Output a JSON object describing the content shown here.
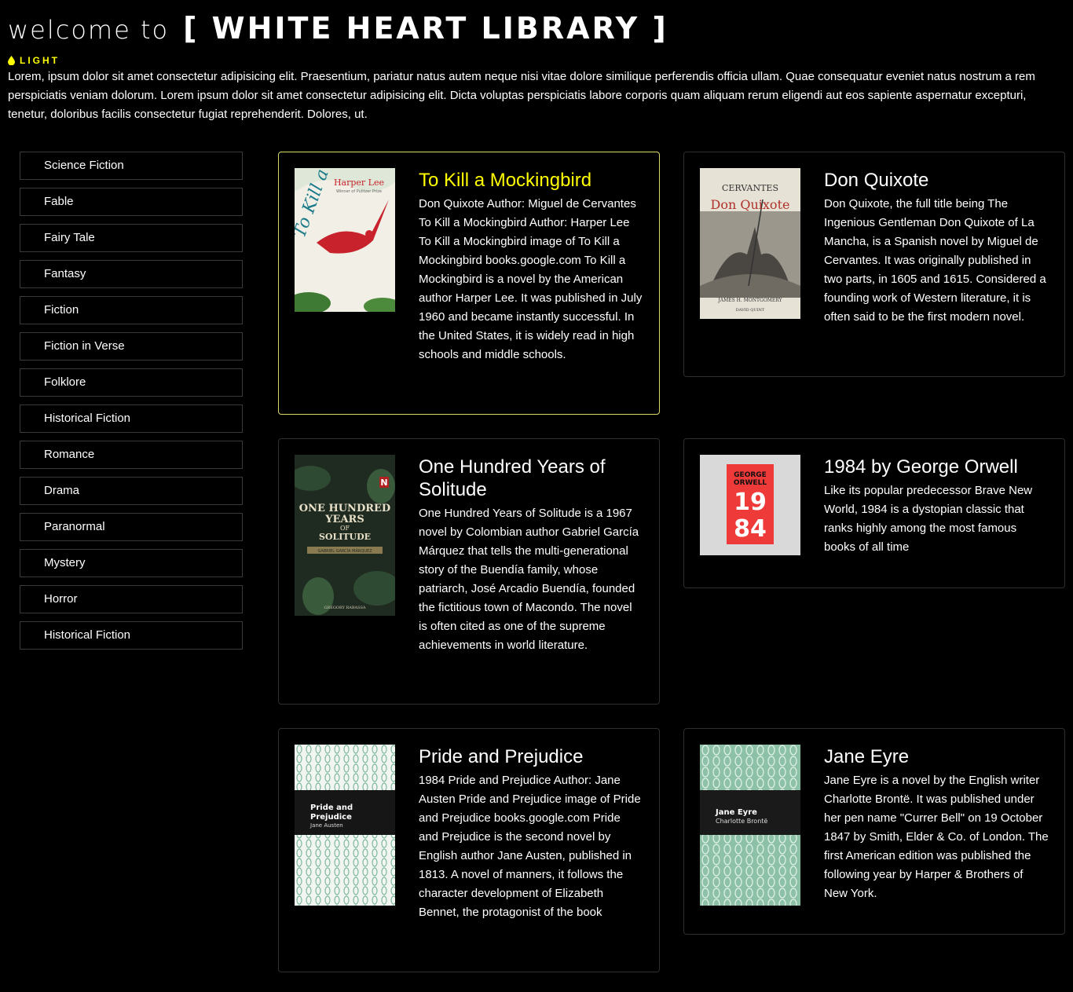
{
  "header": {
    "welcome": "welcome to",
    "library": "[ WHITE HEART LIBRARY ]",
    "toggle_label": "LIGHT",
    "intro": "Lorem, ipsum dolor sit amet consectetur adipisicing elit. Praesentium, pariatur natus autem neque nisi vitae dolore similique perferendis officia ullam. Quae consequatur eveniet natus nostrum a rem perspiciatis veniam dolorum. Lorem ipsum dolor sit amet consectetur adipisicing elit. Dicta voluptas perspiciatis labore corporis quam aliquam rerum eligendi aut eos sapiente aspernatur excepturi, tenetur, doloribus facilis consectetur fugiat reprehenderit. Dolores, ut."
  },
  "sidebar": {
    "items": [
      "Science Fiction",
      "Fable",
      "Fairy Tale",
      "Fantasy",
      "Fiction",
      "Fiction in Verse",
      "Folklore",
      "Historical Fiction",
      "Romance",
      "Drama",
      "Paranormal",
      "Mystery",
      "Horror",
      "Historical Fiction"
    ]
  },
  "books": [
    {
      "title": "To Kill a Mockingbird",
      "description": "Don Quixote Author: Miguel de Cervantes To Kill a Mockingbird Author: Harper Lee To Kill a Mockingbird image of To Kill a Mockingbird books.google.com To Kill a Mockingbird is a novel by the American author Harper Lee. It was published in July 1960 and became instantly successful. In the United States, it is widely read in high schools and middle schools.",
      "cover": {
        "author": "Harper Lee",
        "tagline": "Winner of Pulitzer Prize",
        "script": "To Kill a Mocking bird"
      },
      "active": true
    },
    {
      "title": "Don Quixote",
      "description": "Don Quixote, the full title being The Ingenious Gentleman Don Quixote of La Mancha, is a Spanish novel by Miguel de Cervantes. It was originally published in two parts, in 1605 and 1615. Considered a founding work of Western literature, it is often said to be the first modern novel.",
      "cover": {
        "author": "CERVANTES",
        "script": "Don Quixote",
        "credit": "JAMES H. MONTGOMERY",
        "credit2": "DAVID QUINT"
      }
    },
    {
      "title": "One Hundred Years of Solitude",
      "description": "One Hundred Years of Solitude is a 1967 novel by Colombian author Gabriel García Márquez that tells the multi-generational story of the Buendía family, whose patriarch, José Arcadio Buendía, founded the fictitious town of Macondo. The novel is often cited as one of the supreme achievements in world literature.",
      "cover": {
        "line1": "ONE HUNDRED",
        "line2": "YEARS",
        "line3": "OF",
        "line4": "SOLITUDE",
        "author": "GABRIEL GARCÍA MÁRQUEZ",
        "credit": "GREGORY RABASSA",
        "badge": "N"
      }
    },
    {
      "title": "1984 by George Orwell",
      "description": "Like its popular predecessor Brave New World, 1984 is a dystopian classic that ranks highly among the most famous books of all time",
      "cover": {
        "author1": "GEORGE",
        "author2": "ORWELL",
        "top": "19",
        "bottom": "84"
      }
    },
    {
      "title": "Pride and Prejudice",
      "description": "1984 Pride and Prejudice Author: Jane Austen Pride and Prejudice image of Pride and Prejudice books.google.com Pride and Prejudice is the second novel by English author Jane Austen, published in 1813. A novel of manners, it follows the character development of Elizabeth Bennet, the protagonist of the book",
      "cover": {
        "line1": "Pride and",
        "line2": "Prejudice",
        "author": "Jane Austen"
      }
    },
    {
      "title": "Jane Eyre",
      "description": "Jane Eyre is a novel by the English writer Charlotte Brontë. It was published under her pen name \"Currer Bell\" on 19 October 1847 by Smith, Elder & Co. of London. The first American edition was published the following year by Harper & Brothers of New York.",
      "cover": {
        "line1": "Jane Eyre",
        "author": "Charlotte Brontë"
      }
    }
  ],
  "colors": {
    "background": "#000000",
    "accent": "#ffff00",
    "active_border": "#d9d96a",
    "card_border": "#2e2e2e",
    "sidebar_border": "#3a3a3a"
  }
}
